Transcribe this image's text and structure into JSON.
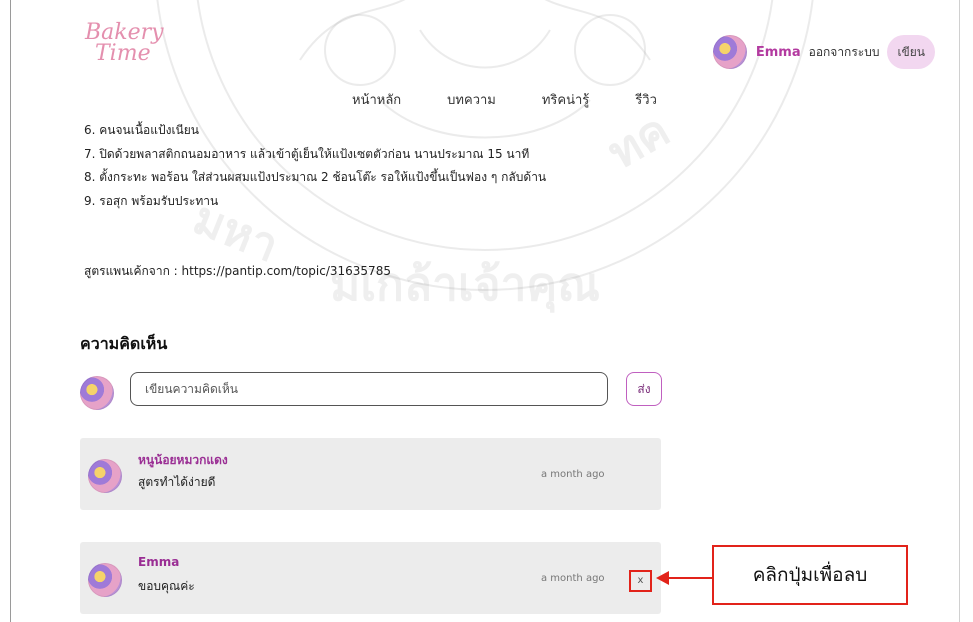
{
  "header": {
    "logo_line1": "Bakery",
    "logo_line2": "Time",
    "user_name": "Emma",
    "logout_label": "ออกจากระบบ",
    "write_label": "เขียน"
  },
  "nav": {
    "items": [
      "หน้าหลัก",
      "บทความ",
      "ทริคน่ารู้",
      "รีวิว"
    ]
  },
  "article": {
    "steps": [
      "6. คนจนเนื้อแป้งเนียน",
      "7. ปิดด้วยพลาสติกถนอมอาหาร แล้วเข้าตู้เย็นให้แป้งเซตตัวก่อน นานประมาณ 15 นาที",
      "8. ตั้งกระทะ พอร้อน ใส่ส่วนผสมแป้งประมาณ 2 ช้อนโต๊ะ รอให้แป้งขึ้นเป็นฟอง ๆ กลับด้าน",
      "9. รอสุก พร้อมรับประทาน"
    ],
    "source": "สูตรแพนเค้กจาก : https://pantip.com/topic/31635785"
  },
  "comments": {
    "title": "ความคิดเห็น",
    "input_placeholder": "เขียนความคิดเห็น",
    "send_label": "ส่ง",
    "items": [
      {
        "author": "หนูน้อยหมวกแดง",
        "text": "สูตรทำได้ง่ายดี",
        "time": "a month ago",
        "delete": ""
      },
      {
        "author": "Emma",
        "text": "ขอบคุณค่ะ",
        "time": "a month ago",
        "delete": "x"
      }
    ]
  },
  "annotation": {
    "callout_text": "คลิกปุ่มเพื่อลบ"
  },
  "colors": {
    "accent": "#b33aa0",
    "annotation_red": "#e2231a",
    "card_bg": "#ececec",
    "write_button_bg": "#f2d7f0"
  },
  "icons": {
    "avatar": "pastry-avatar-icon",
    "arrow": "left-arrow-icon"
  }
}
